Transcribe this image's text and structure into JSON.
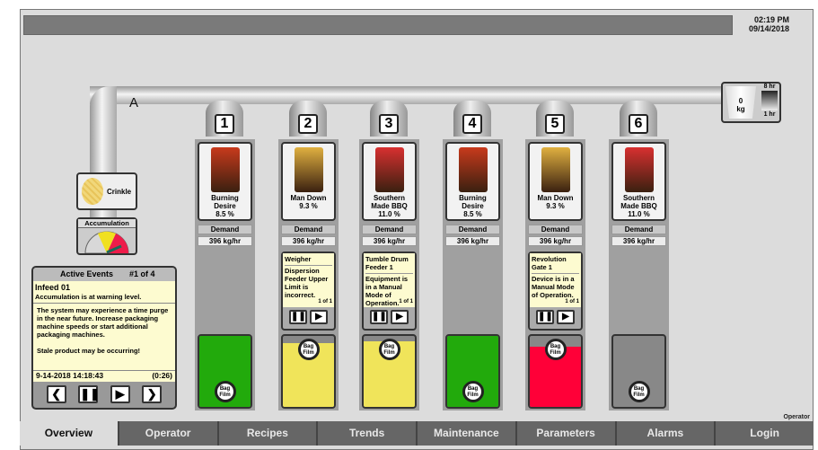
{
  "header": {
    "time": "02:19 PM",
    "date": "09/14/2018"
  },
  "line_label": "A",
  "buffer": {
    "weight_value": "0",
    "weight_unit": "kg",
    "max_label": "8 hr",
    "min_label": "1 hr"
  },
  "product": {
    "name": "Crinkle"
  },
  "accumulation": {
    "label": "Accumulation",
    "level": "warning-to-high"
  },
  "lanes": [
    {
      "number": "1",
      "product": "Burning Desire",
      "percent": "8.5 %",
      "demand_label": "Demand",
      "demand": "396 kg/hr",
      "bag_color": "#c83a1c",
      "bin_fill": 1.0,
      "bin_color": "#22aa0c",
      "alarm": null
    },
    {
      "number": "2",
      "product": "Man Down",
      "percent": "9.3 %",
      "demand_label": "Demand",
      "demand": "396 kg/hr",
      "bag_color": "#e0b040",
      "bin_fill": 0.9,
      "bin_color": "#f0e45a",
      "alarm": {
        "source": "Weigher",
        "message": "Dispersion Feeder Upper Limit is incorrect.",
        "page": "1 of 1"
      }
    },
    {
      "number": "3",
      "product": "Southern Made BBQ",
      "percent": "11.0 %",
      "demand_label": "Demand",
      "demand": "396 kg/hr",
      "bag_color": "#d83030",
      "bin_fill": 0.93,
      "bin_color": "#f0e45a",
      "alarm": {
        "source": "Tumble Drum Feeder 1",
        "message": "Equipment is in a Manual Mode of Operation.",
        "page": "1 of 1"
      }
    },
    {
      "number": "4",
      "product": "Burning Desire",
      "percent": "8.5 %",
      "demand_label": "Demand",
      "demand": "396 kg/hr",
      "bag_color": "#c83a1c",
      "bin_fill": 1.0,
      "bin_color": "#22aa0c",
      "alarm": null
    },
    {
      "number": "5",
      "product": "Man Down",
      "percent": "9.3 %",
      "demand_label": "Demand",
      "demand": "396 kg/hr",
      "bag_color": "#e0b040",
      "bin_fill": 0.85,
      "bin_color": "#ff0038",
      "alarm": {
        "source": "Revolution Gate 1",
        "message": "Device is in a Manual Mode of Operation.",
        "page": "1 of 1"
      }
    },
    {
      "number": "6",
      "product": "Southern Made BBQ",
      "percent": "11.0 %",
      "demand_label": "Demand",
      "demand": "396 kg/hr",
      "bag_color": "#d83030",
      "bin_fill": 0,
      "bin_color": "#888888",
      "alarm": null
    }
  ],
  "bag_film_label": "Bag Film",
  "events": {
    "title": "Active Events",
    "counter": "#1 of 4",
    "source": "Infeed 01",
    "summary": "Accumulation is at warning level.",
    "detail": "The system may experience a time purge in the near future. Increase packaging machine speeds or start additional packaging machines.",
    "note": "Stale product may be occurring!",
    "timestamp": "9-14-2018 14:18:43",
    "elapsed": "(0:26)"
  },
  "tabs": [
    {
      "label": "Overview",
      "active": true
    },
    {
      "label": "Operator"
    },
    {
      "label": "Recipes"
    },
    {
      "label": "Trends"
    },
    {
      "label": "Maintenance"
    },
    {
      "label": "Parameters"
    },
    {
      "label": "Alarms"
    },
    {
      "label": "Login",
      "sup": "Operator"
    }
  ]
}
